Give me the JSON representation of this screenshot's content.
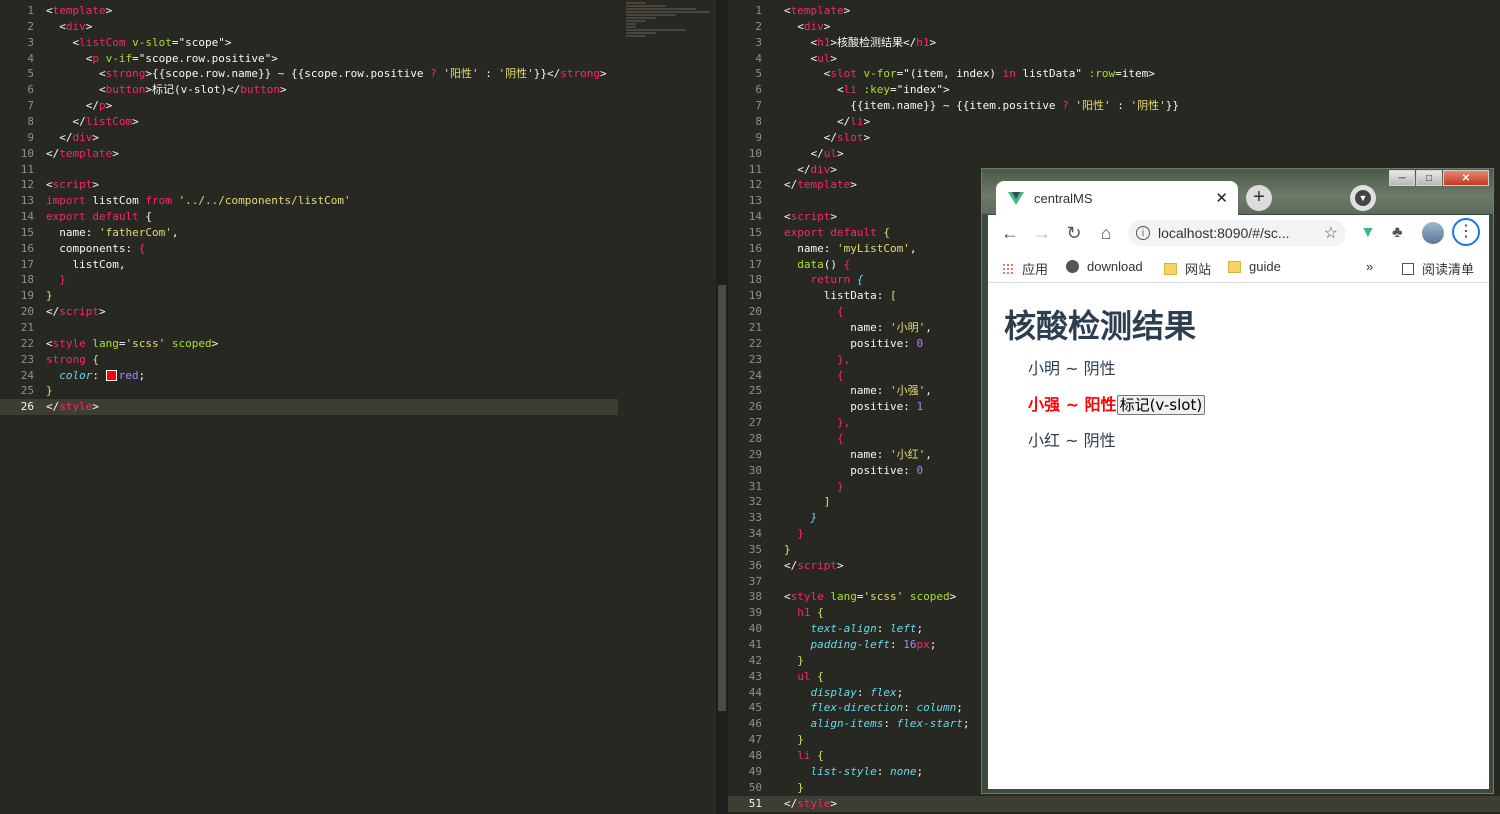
{
  "left_editor": {
    "lines": [
      [
        [
          "<",
          "w"
        ],
        [
          "template",
          "t"
        ],
        [
          ">",
          "w"
        ]
      ],
      [
        [
          "  <",
          "w"
        ],
        [
          "div",
          "t"
        ],
        [
          ">",
          "w"
        ]
      ],
      [
        [
          "    <",
          "w"
        ],
        [
          "listCom",
          "t"
        ],
        [
          " v-slot",
          "a"
        ],
        [
          "=",
          "w"
        ],
        [
          "\"scope\"",
          "w"
        ],
        [
          ">",
          "w"
        ]
      ],
      [
        [
          "      <",
          "w"
        ],
        [
          "p",
          "t"
        ],
        [
          " v-if",
          "a"
        ],
        [
          "=",
          "w"
        ],
        [
          "\"scope.row.positive\"",
          "w"
        ],
        [
          ">",
          "w"
        ]
      ],
      [
        [
          "        <",
          "w"
        ],
        [
          "strong",
          "t"
        ],
        [
          ">{{scope.row.name}} ~ {{scope.row.positive ",
          "w"
        ],
        [
          "?",
          "k"
        ],
        [
          " ",
          "w"
        ],
        [
          "'阳性'",
          "s"
        ],
        [
          " : ",
          "w"
        ],
        [
          "'阴性'",
          "s"
        ],
        [
          "}}</",
          "w"
        ],
        [
          "strong",
          "t"
        ],
        [
          ">",
          "w"
        ]
      ],
      [
        [
          "        <",
          "w"
        ],
        [
          "button",
          "t"
        ],
        [
          ">标记(v-slot)</",
          "w"
        ],
        [
          "button",
          "t"
        ],
        [
          ">",
          "w"
        ]
      ],
      [
        [
          "      </",
          "w"
        ],
        [
          "p",
          "t"
        ],
        [
          ">",
          "w"
        ]
      ],
      [
        [
          "    </",
          "w"
        ],
        [
          "listCom",
          "t"
        ],
        [
          ">",
          "w"
        ]
      ],
      [
        [
          "  </",
          "w"
        ],
        [
          "div",
          "t"
        ],
        [
          ">",
          "w"
        ]
      ],
      [
        [
          "</",
          "w"
        ],
        [
          "template",
          "t"
        ],
        [
          ">",
          "w"
        ]
      ],
      [],
      [
        [
          "<",
          "w"
        ],
        [
          "script",
          "t"
        ],
        [
          ">",
          "w"
        ]
      ],
      [
        [
          "import",
          "k"
        ],
        [
          " listCom ",
          "w"
        ],
        [
          "from",
          "k"
        ],
        [
          " ",
          "w"
        ],
        [
          "'../../components/listCom'",
          "s"
        ]
      ],
      [
        [
          "export",
          "k"
        ],
        [
          " ",
          "w"
        ],
        [
          "default",
          "k"
        ],
        [
          " {",
          "w"
        ]
      ],
      [
        [
          "  name: ",
          "w"
        ],
        [
          "'fatherCom'",
          "s"
        ],
        [
          ",",
          "w"
        ]
      ],
      [
        [
          "  components: ",
          "w"
        ],
        [
          "{",
          "t"
        ]
      ],
      [
        [
          "    listCom,",
          "w"
        ]
      ],
      [
        [
          "  ",
          "w"
        ],
        [
          "}",
          "t"
        ]
      ],
      [
        [
          "}",
          "s"
        ]
      ],
      [
        [
          "</",
          "w"
        ],
        [
          "script",
          "t"
        ],
        [
          ">",
          "w"
        ]
      ],
      [],
      [
        [
          "<",
          "w"
        ],
        [
          "style",
          "t"
        ],
        [
          " lang",
          "a"
        ],
        [
          "=",
          "w"
        ],
        [
          "'scss'",
          "s"
        ],
        [
          " scoped",
          "a"
        ],
        [
          ">",
          "w"
        ]
      ],
      [
        [
          "strong",
          "t"
        ],
        [
          " {",
          "s"
        ]
      ],
      [
        [
          "  ",
          "w"
        ],
        [
          "color",
          "p"
        ],
        [
          ": ",
          "w"
        ],
        [
          "SWATCH",
          "x"
        ],
        [
          "red",
          "n"
        ],
        [
          ";",
          "w"
        ]
      ],
      [
        [
          "}",
          "s"
        ]
      ],
      [
        [
          "</",
          "w"
        ],
        [
          "style",
          "t"
        ],
        [
          ">",
          "w"
        ]
      ]
    ],
    "active_line": 26
  },
  "right_editor": {
    "lines": [
      [
        [
          "<",
          "w"
        ],
        [
          "template",
          "t"
        ],
        [
          ">",
          "w"
        ]
      ],
      [
        [
          "  <",
          "w"
        ],
        [
          "div",
          "t"
        ],
        [
          ">",
          "w"
        ]
      ],
      [
        [
          "    <",
          "w"
        ],
        [
          "h1",
          "t"
        ],
        [
          ">核酸检测结果</",
          "w"
        ],
        [
          "h1",
          "t"
        ],
        [
          ">",
          "w"
        ]
      ],
      [
        [
          "    <",
          "w"
        ],
        [
          "ul",
          "t"
        ],
        [
          ">",
          "w"
        ]
      ],
      [
        [
          "      <",
          "w"
        ],
        [
          "slot",
          "t"
        ],
        [
          " v-for",
          "a"
        ],
        [
          "=",
          "w"
        ],
        [
          "\"(item, index) ",
          "w"
        ],
        [
          "in",
          "k"
        ],
        [
          " listData\"",
          "w"
        ],
        [
          " :row",
          "a"
        ],
        [
          "=",
          "w"
        ],
        [
          "item",
          "w"
        ],
        [
          ">",
          "w"
        ]
      ],
      [
        [
          "        <",
          "w"
        ],
        [
          "li",
          "t"
        ],
        [
          " :key",
          "a"
        ],
        [
          "=",
          "w"
        ],
        [
          "\"index\"",
          "w"
        ],
        [
          ">",
          "w"
        ]
      ],
      [
        [
          "          {{item.name}} ~ {{item.positive ",
          "w"
        ],
        [
          "?",
          "k"
        ],
        [
          " ",
          "w"
        ],
        [
          "'阳性'",
          "s"
        ],
        [
          " : ",
          "w"
        ],
        [
          "'阴性'",
          "s"
        ],
        [
          "}}",
          "w"
        ]
      ],
      [
        [
          "        </",
          "w"
        ],
        [
          "li",
          "t"
        ],
        [
          ">",
          "w"
        ]
      ],
      [
        [
          "      </",
          "w"
        ],
        [
          "slot",
          "t"
        ],
        [
          ">",
          "w"
        ]
      ],
      [
        [
          "    </",
          "w"
        ],
        [
          "ul",
          "t"
        ],
        [
          ">",
          "w"
        ]
      ],
      [
        [
          "  </",
          "w"
        ],
        [
          "div",
          "t"
        ],
        [
          ">",
          "w"
        ]
      ],
      [
        [
          "</",
          "w"
        ],
        [
          "template",
          "t"
        ],
        [
          ">",
          "w"
        ]
      ],
      [],
      [
        [
          "<",
          "w"
        ],
        [
          "script",
          "t"
        ],
        [
          ">",
          "w"
        ]
      ],
      [
        [
          "export",
          "k"
        ],
        [
          " ",
          "w"
        ],
        [
          "default",
          "k"
        ],
        [
          " {",
          "s"
        ]
      ],
      [
        [
          "  name: ",
          "w"
        ],
        [
          "'myListCom'",
          "s"
        ],
        [
          ",",
          "w"
        ]
      ],
      [
        [
          "  data",
          "a"
        ],
        [
          "() ",
          "w"
        ],
        [
          "{",
          "t"
        ]
      ],
      [
        [
          "    ",
          "w"
        ],
        [
          "return",
          "k"
        ],
        [
          " {",
          "p"
        ]
      ],
      [
        [
          "      listData: ",
          "w"
        ],
        [
          "[",
          "s"
        ]
      ],
      [
        [
          "        ",
          "w"
        ],
        [
          "{",
          "t"
        ]
      ],
      [
        [
          "          name: ",
          "w"
        ],
        [
          "'小明'",
          "s"
        ],
        [
          ",",
          "w"
        ]
      ],
      [
        [
          "          positive: ",
          "w"
        ],
        [
          "0",
          "n"
        ]
      ],
      [
        [
          "        ",
          "w"
        ],
        [
          "},",
          "t"
        ]
      ],
      [
        [
          "        ",
          "w"
        ],
        [
          "{",
          "t"
        ]
      ],
      [
        [
          "          name: ",
          "w"
        ],
        [
          "'小强'",
          "s"
        ],
        [
          ",",
          "w"
        ]
      ],
      [
        [
          "          positive: ",
          "w"
        ],
        [
          "1",
          "n"
        ]
      ],
      [
        [
          "        ",
          "w"
        ],
        [
          "},",
          "t"
        ]
      ],
      [
        [
          "        ",
          "w"
        ],
        [
          "{",
          "t"
        ]
      ],
      [
        [
          "          name: ",
          "w"
        ],
        [
          "'小红'",
          "s"
        ],
        [
          ",",
          "w"
        ]
      ],
      [
        [
          "          positive: ",
          "w"
        ],
        [
          "0",
          "n"
        ]
      ],
      [
        [
          "        ",
          "w"
        ],
        [
          "}",
          "t"
        ]
      ],
      [
        [
          "      ",
          "w"
        ],
        [
          "]",
          "s"
        ]
      ],
      [
        [
          "    ",
          "w"
        ],
        [
          "}",
          "p"
        ]
      ],
      [
        [
          "  ",
          "w"
        ],
        [
          "}",
          "t"
        ]
      ],
      [
        [
          "}",
          "s"
        ]
      ],
      [
        [
          "</",
          "w"
        ],
        [
          "script",
          "t"
        ],
        [
          ">",
          "w"
        ]
      ],
      [],
      [
        [
          "<",
          "w"
        ],
        [
          "style",
          "t"
        ],
        [
          " lang",
          "a"
        ],
        [
          "=",
          "w"
        ],
        [
          "'scss'",
          "s"
        ],
        [
          " scoped",
          "a"
        ],
        [
          ">",
          "w"
        ]
      ],
      [
        [
          "  ",
          "w"
        ],
        [
          "h1",
          "t"
        ],
        [
          " {",
          "s"
        ]
      ],
      [
        [
          "    ",
          "w"
        ],
        [
          "text-align",
          "p"
        ],
        [
          ": ",
          "w"
        ],
        [
          "left",
          "p"
        ],
        [
          ";",
          "w"
        ]
      ],
      [
        [
          "    ",
          "w"
        ],
        [
          "padding-left",
          "p"
        ],
        [
          ": ",
          "w"
        ],
        [
          "16",
          "n"
        ],
        [
          "px",
          "t"
        ],
        [
          ";",
          "w"
        ]
      ],
      [
        [
          "  ",
          "w"
        ],
        [
          "}",
          "s"
        ]
      ],
      [
        [
          "  ",
          "w"
        ],
        [
          "ul",
          "t"
        ],
        [
          " {",
          "s"
        ]
      ],
      [
        [
          "    ",
          "w"
        ],
        [
          "display",
          "p"
        ],
        [
          ": ",
          "w"
        ],
        [
          "flex",
          "p"
        ],
        [
          ";",
          "w"
        ]
      ],
      [
        [
          "    ",
          "w"
        ],
        [
          "flex-direction",
          "p"
        ],
        [
          ": ",
          "w"
        ],
        [
          "column",
          "p"
        ],
        [
          ";",
          "w"
        ]
      ],
      [
        [
          "    ",
          "w"
        ],
        [
          "align-items",
          "p"
        ],
        [
          ": ",
          "w"
        ],
        [
          "flex-start",
          "p"
        ],
        [
          ";",
          "w"
        ]
      ],
      [
        [
          "  ",
          "w"
        ],
        [
          "}",
          "s"
        ]
      ],
      [
        [
          "  ",
          "w"
        ],
        [
          "li",
          "t"
        ],
        [
          " {",
          "s"
        ]
      ],
      [
        [
          "    ",
          "w"
        ],
        [
          "list-style",
          "p"
        ],
        [
          ": ",
          "w"
        ],
        [
          "none",
          "p"
        ],
        [
          ";",
          "w"
        ]
      ],
      [
        [
          "  ",
          "w"
        ],
        [
          "}",
          "s"
        ]
      ],
      [
        [
          "</",
          "w"
        ],
        [
          "style",
          "t"
        ],
        [
          ">",
          "w"
        ]
      ]
    ],
    "active_line": 51
  },
  "browser": {
    "tab_title": "centralMS",
    "url": "localhost:8090/#/sc...",
    "bookmarks": [
      "应用",
      "download",
      "网站",
      "guide",
      "阅读清单"
    ],
    "page": {
      "heading": "核酸检测结果",
      "items": [
        {
          "text": "小明 ~ 阴性",
          "strong": false
        },
        {
          "text": "小强 ~ 阳性",
          "strong": true,
          "button": "标记(v-slot)"
        },
        {
          "text": "小红 ~ 阴性",
          "strong": false
        }
      ]
    }
  },
  "colors": {
    "editor_bg": "#272822",
    "tag": "#f92672",
    "attr": "#a6e22e",
    "string": "#e6db74",
    "number": "#ae81ff",
    "property": "#66d9ef",
    "positive": "#ff0000"
  }
}
